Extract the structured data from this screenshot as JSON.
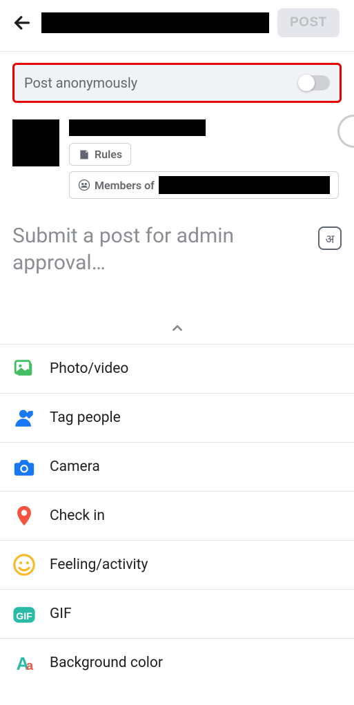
{
  "header": {
    "post_button": "POST"
  },
  "anon": {
    "label": "Post anonymously",
    "enabled": false
  },
  "profile": {
    "rules_label": "Rules",
    "members_prefix": "Members of"
  },
  "compose": {
    "placeholder": "Submit a post for admin approval…",
    "lang_badge": "अ"
  },
  "options": [
    {
      "key": "photo-video",
      "label": "Photo/video",
      "icon": "image-icon",
      "color": "#45bd62"
    },
    {
      "key": "tag-people",
      "label": "Tag people",
      "icon": "person-tag-icon",
      "color": "#1877f2"
    },
    {
      "key": "camera",
      "label": "Camera",
      "icon": "camera-icon",
      "color": "#1877f2"
    },
    {
      "key": "check-in",
      "label": "Check in",
      "icon": "location-pin-icon",
      "color": "#f5533d"
    },
    {
      "key": "feeling-activity",
      "label": "Feeling/activity",
      "icon": "smiley-icon",
      "color": "#f7b928"
    },
    {
      "key": "gif",
      "label": "GIF",
      "icon": "gif-icon",
      "color": "#2abba7"
    },
    {
      "key": "background-color",
      "label": "Background color",
      "icon": "text-format-icon",
      "color": "#2abba7"
    }
  ]
}
